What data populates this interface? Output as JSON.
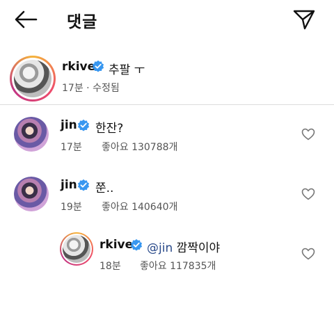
{
  "header": {
    "title": "댓글",
    "back_icon": "arrow-left-icon",
    "send_icon": "paper-plane-icon"
  },
  "caption": {
    "username": "rkive",
    "text": "추팔 ㅜ",
    "time": "17분",
    "separator": "·",
    "edited": "수정됨"
  },
  "comments": [
    {
      "username": "jin",
      "text": "한잔?",
      "time": "17분",
      "likes": "좋아요 130788개"
    },
    {
      "username": "jin",
      "text": "쭌..",
      "time": "19분",
      "likes": "좋아요 140640개"
    }
  ],
  "reply": {
    "username": "rkive",
    "mention": "@jin",
    "text": "깜짝이야",
    "time": "18분",
    "likes": "좋아요 117835개"
  },
  "colors": {
    "verified": "#3897f0",
    "mention": "#2a4a8a"
  }
}
